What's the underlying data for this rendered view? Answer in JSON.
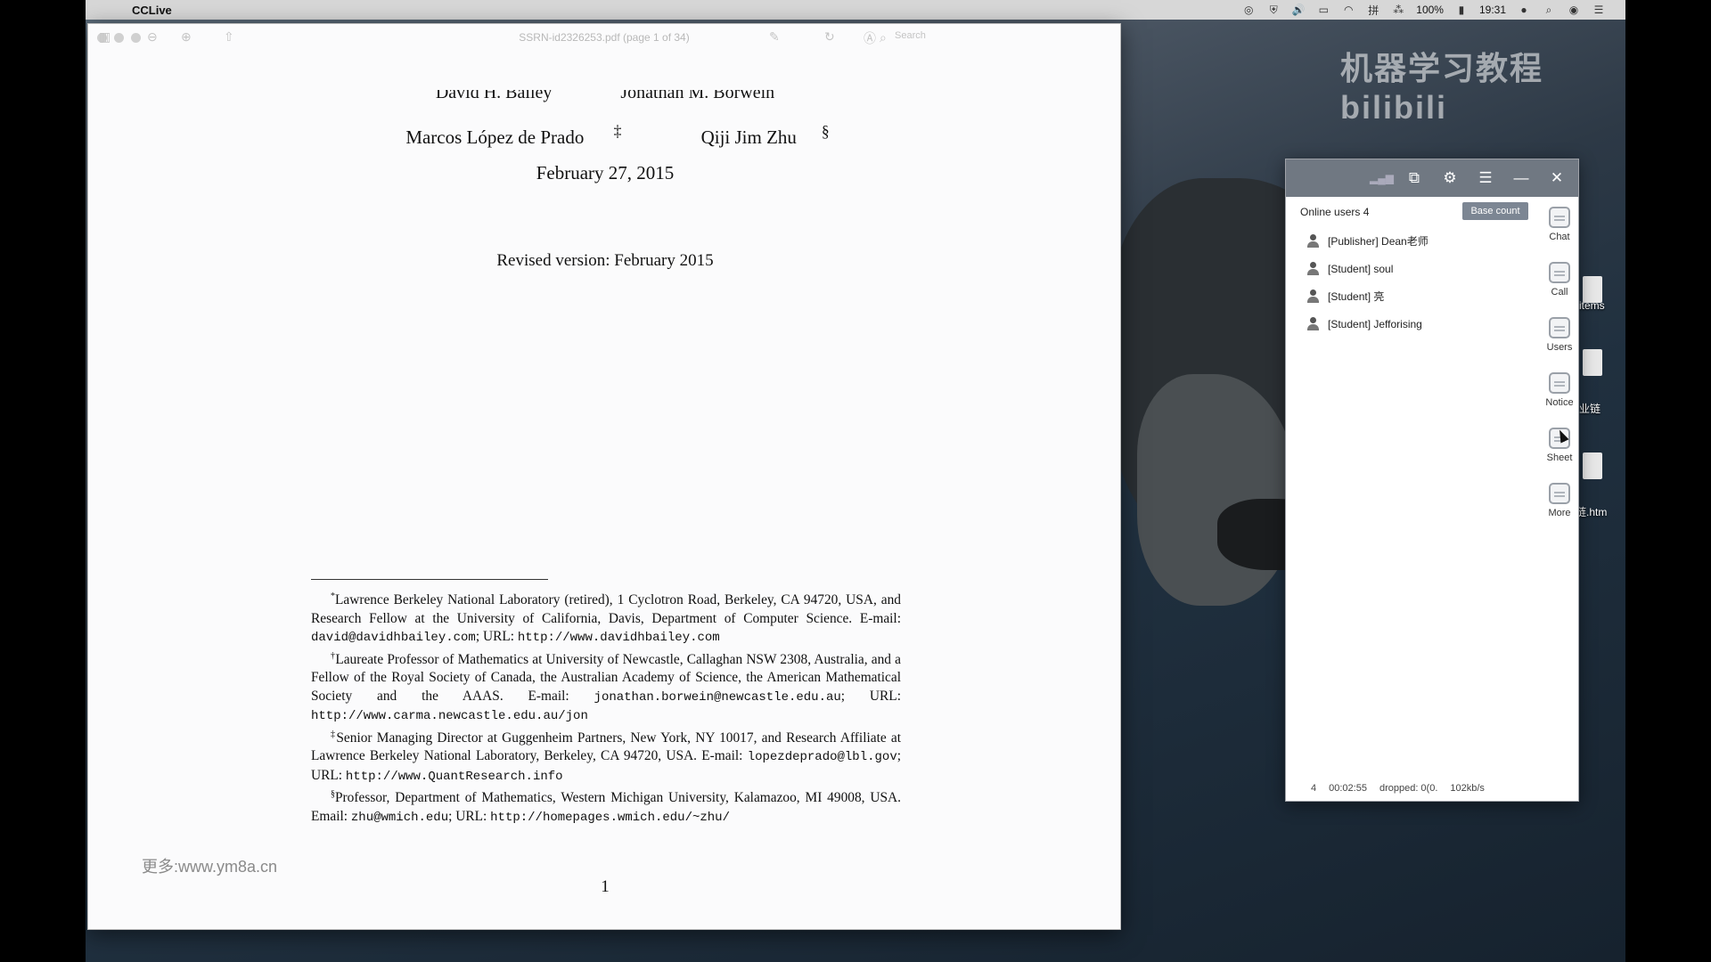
{
  "menubar": {
    "app_name": "CCLive",
    "battery": "100%",
    "time": "19:31"
  },
  "pdf": {
    "filename": "SSRN-id2326253.pdf (page 1 of 34)",
    "search_placeholder": "Search",
    "authors_top": [
      "David H. Bailey",
      "Jonathan M. Borwein"
    ],
    "author3": "Marcos López de Prado",
    "author3_mark": "‡",
    "author4": "Qiji Jim Zhu",
    "author4_mark": "§",
    "date": "February 27, 2015",
    "revised": "Revised version: February 2015",
    "fn1_mark": "*",
    "fn1_text": "Lawrence Berkeley National Laboratory (retired), 1 Cyclotron Road, Berkeley, CA 94720, USA, and Research Fellow at the University of California, Davis, Department of Computer Science. E-mail: ",
    "fn1_email": "david@davidhbailey.com",
    "fn1_url_label": "; URL: ",
    "fn1_url": "http://www.davidhbailey.com",
    "fn2_mark": "†",
    "fn2_text": "Laureate Professor of Mathematics at University of Newcastle, Callaghan NSW 2308, Australia, and a Fellow of the Royal Society of Canada, the Australian Academy of Science, the American Mathematical Society and the AAAS. E-mail: ",
    "fn2_email": "jonathan.borwein@newcastle.edu.au",
    "fn2_url_label": "; URL: ",
    "fn2_url": "http://www.carma.newcastle.edu.au/jon",
    "fn3_mark": "‡",
    "fn3_text": "Senior Managing Director at Guggenheim Partners, New York, NY 10017, and Research Affiliate at Lawrence Berkeley National Laboratory, Berkeley, CA 94720, USA. E-mail: ",
    "fn3_email": "lopezdeprado@lbl.gov",
    "fn3_url_label": "; URL: ",
    "fn3_url": "http://www.QuantResearch.info",
    "fn4_mark": "§",
    "fn4_text": "Professor, Department of Mathematics, Western Michigan University, Kalamazoo, MI 49008, USA. Email: ",
    "fn4_email": "zhu@wmich.edu",
    "fn4_url_label": "; URL: ",
    "fn4_url": "http://homepages.wmich.edu/~zhu/",
    "page_number": "1",
    "watermark_url": "更多:www.ym8a.cn"
  },
  "watermark": {
    "text": "机器学习教程",
    "brand": "bilibili"
  },
  "desktop": {
    "label_items": "items",
    "label_chain": "业链",
    "label_htm": "链.htm"
  },
  "cclive": {
    "online_label": "Online users 4",
    "base_count": "Base count",
    "users": [
      "[Publisher] Dean老师",
      "[Student] soul",
      "[Student] 亮",
      "[Student] Jefforising"
    ],
    "side": {
      "chat": "Chat",
      "call": "Call",
      "users": "Users",
      "notice": "Notice",
      "sheet": "Sheet",
      "more": "More"
    },
    "stats": {
      "count": "4",
      "elapsed": "00:02:55",
      "dropped": "dropped: 0(0.",
      "rate": "102kb/s"
    }
  }
}
